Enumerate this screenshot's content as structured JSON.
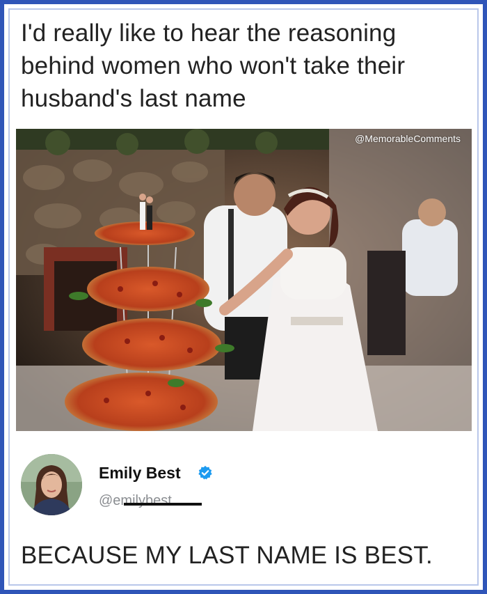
{
  "post": {
    "text": "I'd really like to hear the reasoning\nbehind women who won't take their\nhusband's last name"
  },
  "image": {
    "watermark": "@MemorableComments",
    "subject_icon": "wedding-pizza-cake-photo"
  },
  "reply": {
    "author_name": "Emily Best",
    "author_handle": "@emilybest",
    "verified_icon": "verified-badge-icon",
    "text": "BECAUSE MY LAST NAME IS BEST."
  },
  "colors": {
    "frame": "#2f55b8",
    "verified": "#1d9bf0",
    "text": "#222222",
    "handle": "#8a8d91"
  }
}
